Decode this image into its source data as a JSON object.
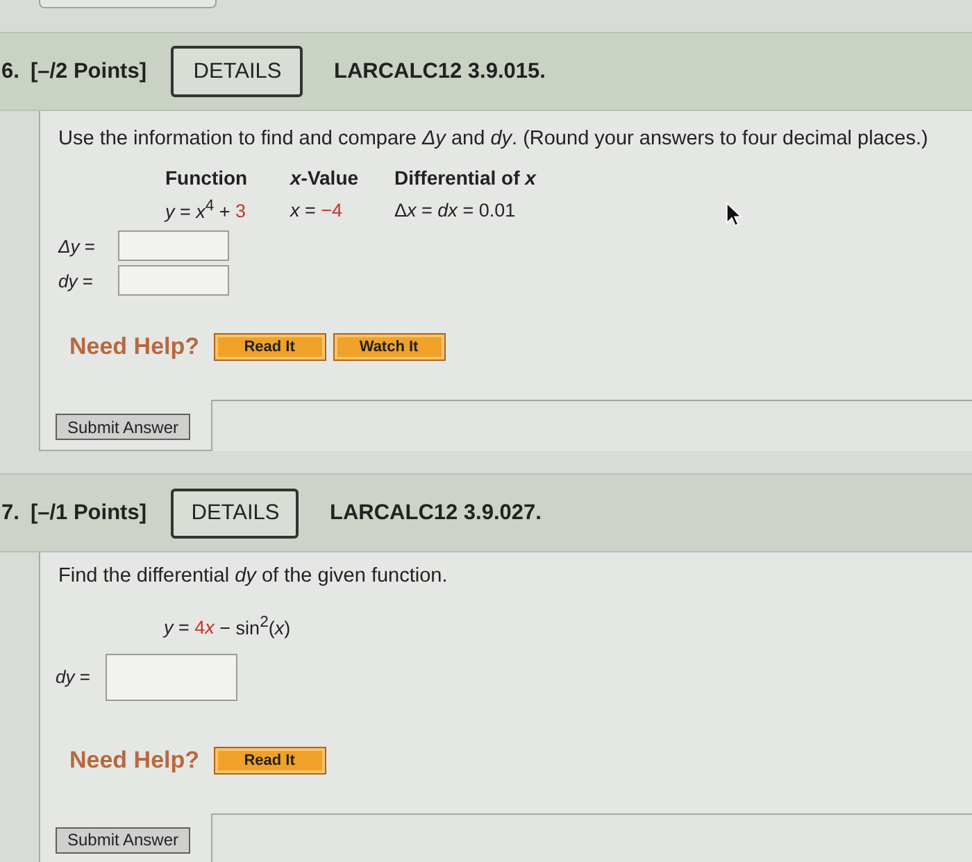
{
  "questions": [
    {
      "kind": "table",
      "number": "6.",
      "points": "[–/2 Points]",
      "details_button": "DETAILS",
      "code": "LARCALC12 3.9.015.",
      "prompt": "Use the information to find and compare *Δy* and *dy*. (Round your answers to four decimal places.)",
      "table": {
        "columns": [
          "Function",
          "*x*-Value",
          "Differential of *x*"
        ],
        "rows": [
          [
            [
              {
                "text": "*y* = *x*$^{4}$ + ",
                "highlighted": false
              },
              {
                "text": "3",
                "highlighted": true
              }
            ],
            [
              {
                "text": "*x* = ",
                "highlighted": false
              },
              {
                "text": "−4",
                "highlighted": true
              }
            ],
            [
              {
                "text": "Δ",
                "highlighted": false
              },
              {
                "text": "*x* = *dx* = 0.01",
                "highlighted": false
              }
            ]
          ]
        ]
      },
      "answers": [
        {
          "label": "*Δy* ="
        },
        {
          "label": "*dy* ="
        }
      ],
      "help_label": "Need Help?",
      "help_buttons": [
        "Read It",
        "Watch It"
      ],
      "submit_button": "Submit Answer"
    },
    {
      "kind": "formula",
      "number": "7.",
      "points": "[–/1 Points]",
      "details_button": "DETAILS",
      "code": "LARCALC12 3.9.027.",
      "prompt": "Find the differential *dy* of the given function.",
      "formula": [
        {
          "text": "*y* = ",
          "highlighted": false
        },
        {
          "text": "4",
          "highlighted": true
        },
        {
          "text": "*x*",
          "highlighted": true
        },
        {
          "text": " − sin$^{2}$(*x*)",
          "highlighted": false
        }
      ],
      "answers": [
        {
          "label": "*dy* ="
        }
      ],
      "help_label": "Need Help?",
      "help_buttons": [
        "Read It"
      ],
      "submit_button": "Submit Answer"
    }
  ]
}
